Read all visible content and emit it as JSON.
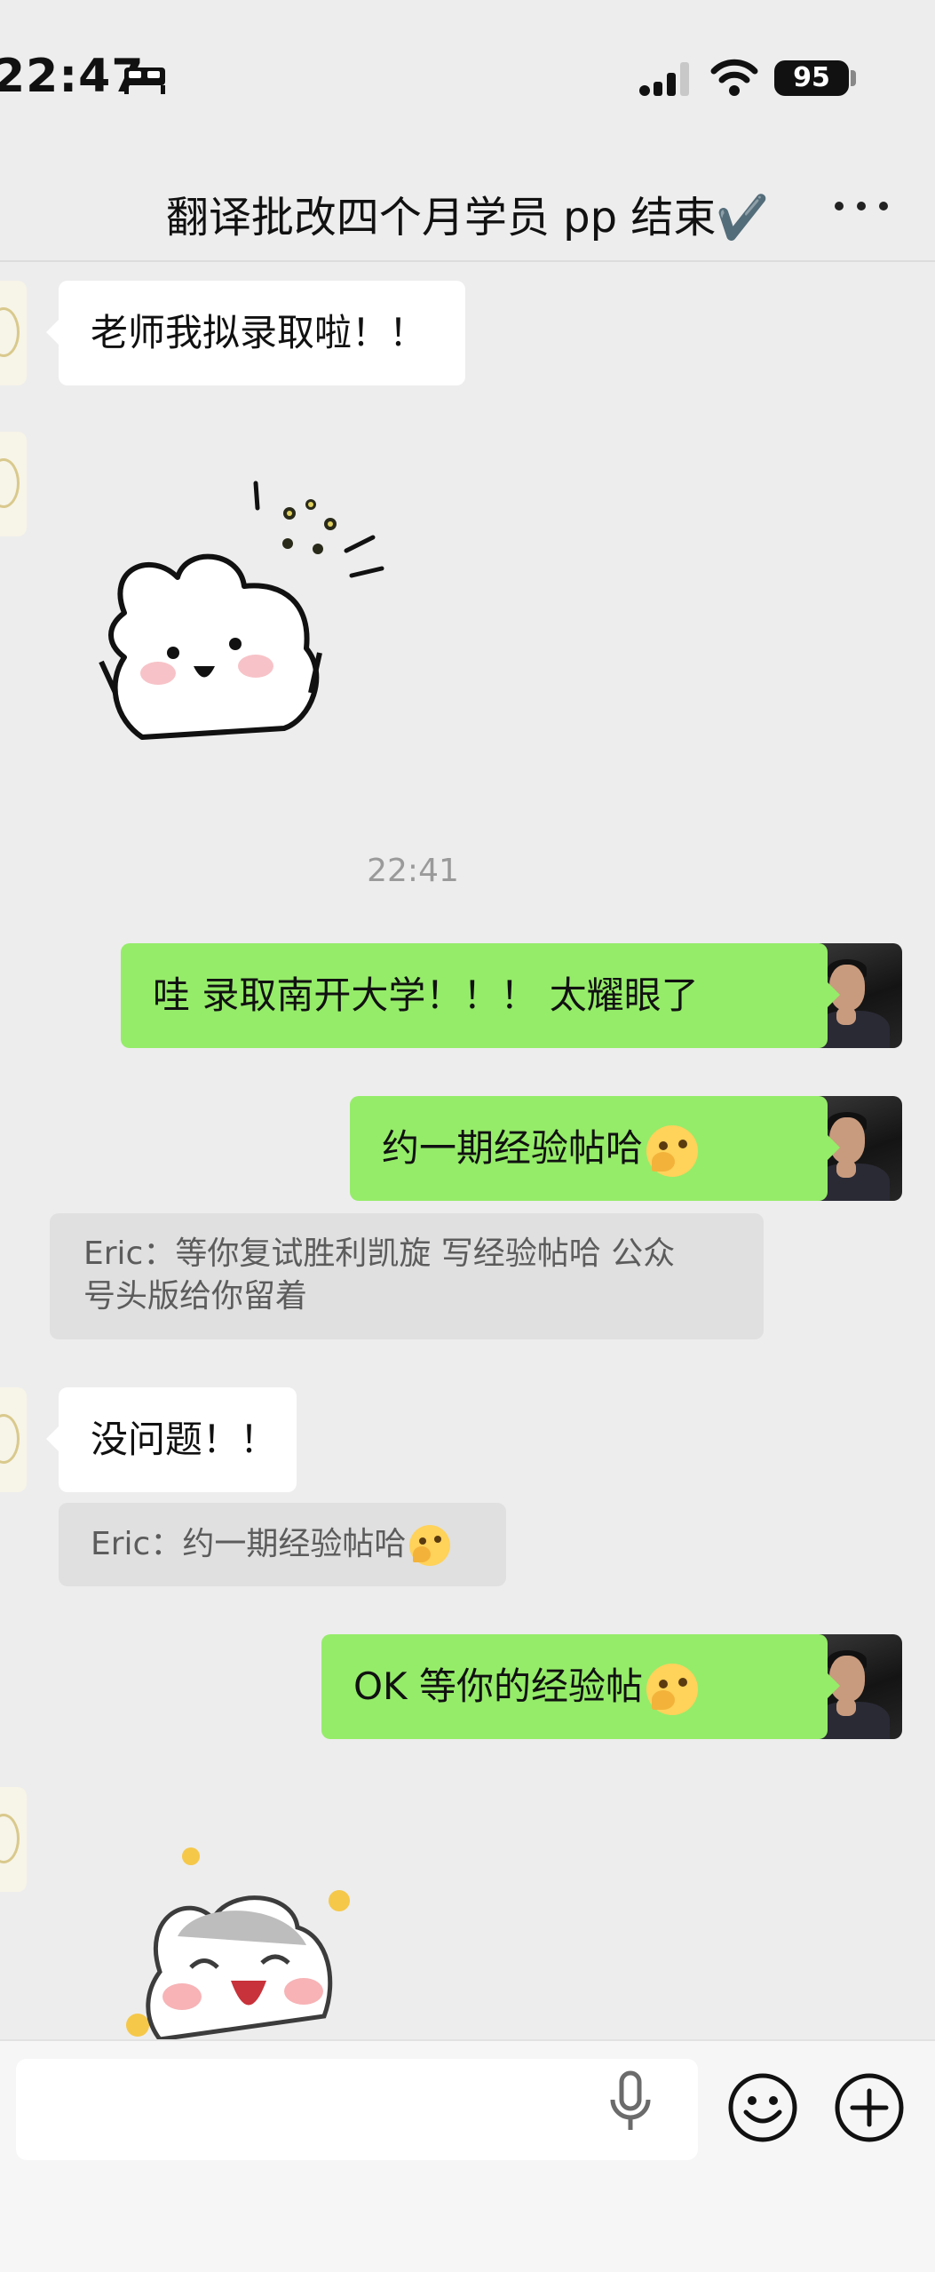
{
  "status_bar": {
    "time": "22:47",
    "battery": "95"
  },
  "header": {
    "title": "翻译批改四个月学员 pp 结束✔️"
  },
  "messages": {
    "m1": "老师我拟录取啦！！",
    "timestamp": "22:41",
    "m2": "哇 录取南开大学！！！  太耀眼了",
    "m3": "约一期经验帖哈",
    "quote1_line1": "Eric：等你复试胜利凯旋 写经验帖哈  公众",
    "quote1_line2": "号头版给你留着",
    "m4": "没问题！！",
    "quote2": "Eric：约一期经验帖哈",
    "m5": "OK 等你的经验帖"
  },
  "icons": {
    "status": [
      "bed-icon",
      "signal-icon",
      "wifi-icon",
      "battery-icon"
    ],
    "header": [
      "more-icon"
    ],
    "emoji": "smirk-emoji",
    "input": [
      "mic-icon",
      "emoji-icon",
      "plus-icon"
    ]
  },
  "colors": {
    "background": "#ededed",
    "outgoing_bubble": "#95ec69",
    "incoming_bubble": "#ffffff",
    "quote_bg": "#e0e0e0"
  }
}
